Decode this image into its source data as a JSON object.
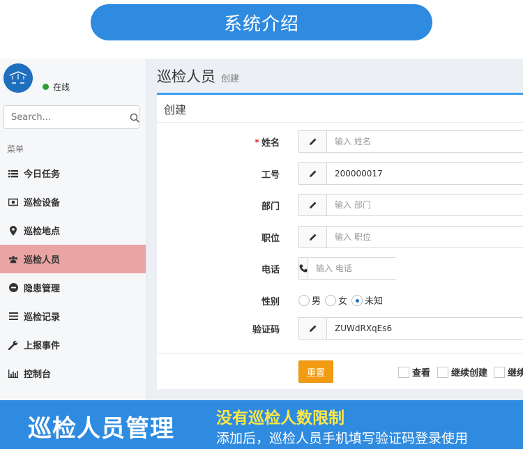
{
  "header_pill": {
    "title": "系统介绍"
  },
  "sidebar": {
    "status": "在线",
    "search_placeholder": "Search...",
    "menu_header": "菜单",
    "items": [
      {
        "label": "今日任务",
        "icon": "tasks-icon",
        "active": false
      },
      {
        "label": "巡检设备",
        "icon": "device-icon",
        "active": false
      },
      {
        "label": "巡检地点",
        "icon": "location-pin-icon",
        "active": false
      },
      {
        "label": "巡检人员",
        "icon": "users-icon",
        "active": true
      },
      {
        "label": "隐患管理",
        "icon": "minus-circle-icon",
        "active": false
      },
      {
        "label": "巡检记录",
        "icon": "list-icon",
        "active": false
      },
      {
        "label": "上报事件",
        "icon": "wrench-icon",
        "active": false
      },
      {
        "label": "控制台",
        "icon": "bar-chart-icon",
        "active": false
      }
    ]
  },
  "page": {
    "title": "巡检人员",
    "subtitle": "创建"
  },
  "form": {
    "box_title": "创建",
    "fields": [
      {
        "label": "姓名",
        "required": true,
        "icon": "pencil-icon",
        "value": "",
        "placeholder": "输入 姓名"
      },
      {
        "label": "工号",
        "required": false,
        "icon": "pencil-icon",
        "value": "200000017",
        "placeholder": ""
      },
      {
        "label": "部门",
        "required": false,
        "icon": "pencil-icon",
        "value": "",
        "placeholder": "输入 部门"
      },
      {
        "label": "职位",
        "required": false,
        "icon": "pencil-icon",
        "value": "",
        "placeholder": "输入 职位"
      },
      {
        "label": "电话",
        "required": false,
        "icon": "phone-icon",
        "value": "",
        "placeholder": "输入 电话"
      }
    ],
    "gender": {
      "label": "性别",
      "options": [
        "男",
        "女",
        "未知"
      ],
      "selected": "未知"
    },
    "code": {
      "label": "验证码",
      "icon": "pencil-icon",
      "value": "ZUWdRXqEs6"
    },
    "reset_label": "重置",
    "checks": [
      "查看",
      "继续创建",
      "继续"
    ]
  },
  "banner": {
    "headline": "巡检人员管理",
    "highlight": "没有巡检人数限制",
    "description": "添加后，巡检人员手机填写验证码登录使用"
  },
  "colors": {
    "primary": "#2f8be0",
    "highlight": "#ffe843",
    "active_menu": "#eaa4a4",
    "reset_button": "#f39c12"
  }
}
